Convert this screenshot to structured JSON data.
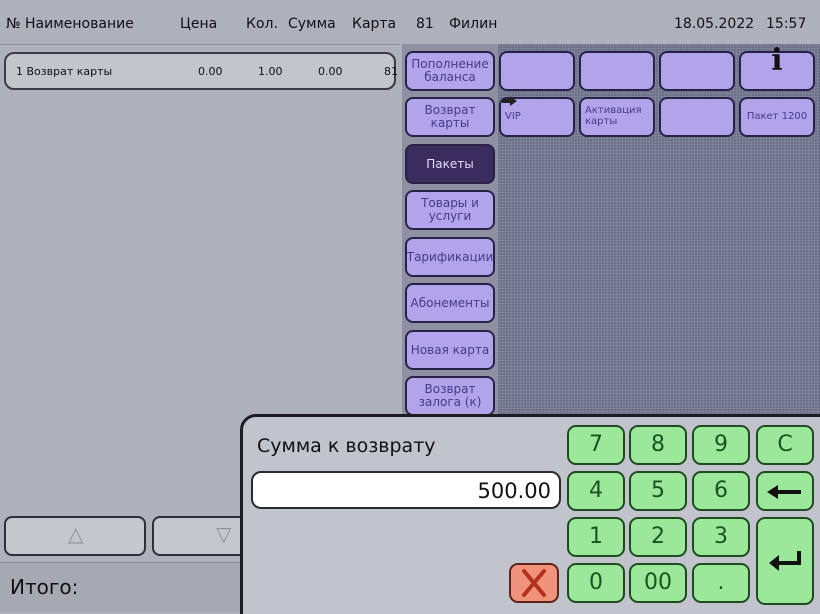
{
  "header": {
    "col_number_name": "№ Наименование",
    "col_price": "Цена",
    "col_qty": "Кол.",
    "col_sum": "Сумма",
    "col_card": "Карта",
    "operator_id": "81",
    "operator_name": "Филин",
    "date": "18.05.2022",
    "time": "15:57"
  },
  "receipt": {
    "rows": [
      {
        "name": "1 Возврат карты",
        "price": "0.00",
        "qty": "1.00",
        "sum": "0.00",
        "card": "81"
      }
    ],
    "scroll_up": "△",
    "scroll_down": "▽",
    "total_label": "Итого:"
  },
  "categories": [
    "Пополнение баланса",
    "Возврат карты",
    "Пакеты",
    "Товары и услуги",
    "Тарификации",
    "Абонементы",
    "Новая карта",
    "Возврат залога (к)"
  ],
  "active_category": 2,
  "tiles": [
    "",
    "",
    "",
    "",
    "VIP",
    "Активация карты",
    "",
    "Пакет 1200"
  ],
  "icons": {
    "info": "i"
  },
  "numpad": {
    "title": "Сумма к возврату",
    "value": "500.00",
    "keys": [
      "7",
      "8",
      "9",
      "C",
      "4",
      "5",
      "6",
      "1",
      "2",
      "3",
      "0",
      "00",
      "."
    ],
    "backspace": "⟵",
    "enter": "↵"
  },
  "colors": {
    "category_button": "#b2a4ea",
    "category_active": "#3a2d5e",
    "numpad_key": "#9be89b",
    "cancel_key": "#f0937c"
  }
}
